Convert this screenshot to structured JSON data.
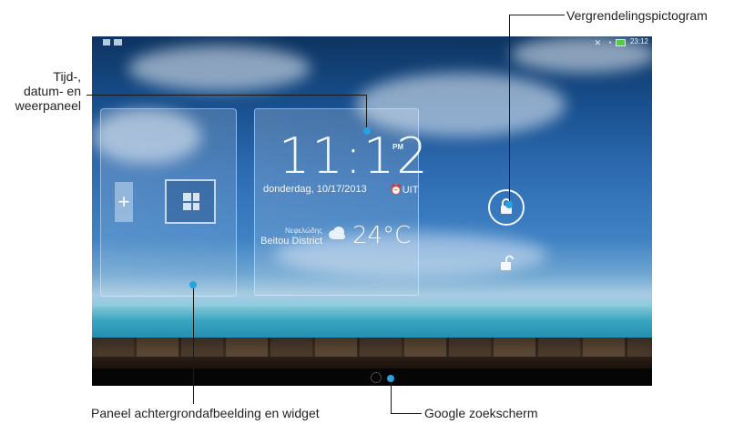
{
  "callouts": {
    "time_panel": "Tijd-,\ndatum- en\nweerpaneel",
    "lock_icon": "Vergrendelingspictogram",
    "wallpaper_widget": "Paneel achtergrondafbeelding en widget",
    "google_search": "Google zoekscherm"
  },
  "status_bar": {
    "time": "23:12",
    "icons": [
      "notification-icon",
      "image-icon",
      "mute-icon",
      "wifi-icon",
      "battery-icon"
    ]
  },
  "clock": {
    "time": "11:12",
    "ampm": "PM",
    "date": "donderdag, 10/17/2013",
    "alarm": "UIT"
  },
  "weather": {
    "description": "Νεφελώδης",
    "location": "Beitou District",
    "temperature": "24°C",
    "icon": "cloud-icon"
  },
  "panel": {
    "add_label": "+"
  },
  "colors": {
    "callout_dot": "#27a3e0",
    "battery": "#4cd137"
  }
}
